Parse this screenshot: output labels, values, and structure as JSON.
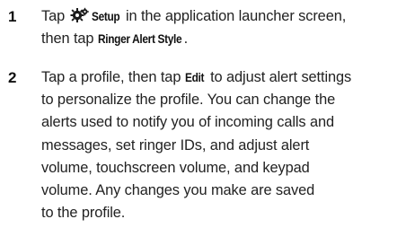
{
  "steps": [
    {
      "number": "1",
      "part1": "Tap ",
      "icon": "setup-gear-icon",
      "keyword1": "Setup",
      "part2": " in the application launcher screen,",
      "part3": "then tap ",
      "keyword2": "Ringer Alert Style",
      "part4": "."
    },
    {
      "number": "2",
      "part1": "Tap a profile, then tap ",
      "keyword1": "Edit",
      "part2": " to adjust alert settings",
      "line2": "to personalize the profile. You can change the",
      "line3": "alerts used to notify you of incoming calls and",
      "line4": "messages, set ringer IDs, and adjust alert",
      "line5": "volume, touchscreen volume, and keypad",
      "line6": "volume. Any changes you make are saved",
      "line7": "to the profile."
    }
  ],
  "colors": {
    "text": "#222222",
    "background": "#ffffff"
  }
}
